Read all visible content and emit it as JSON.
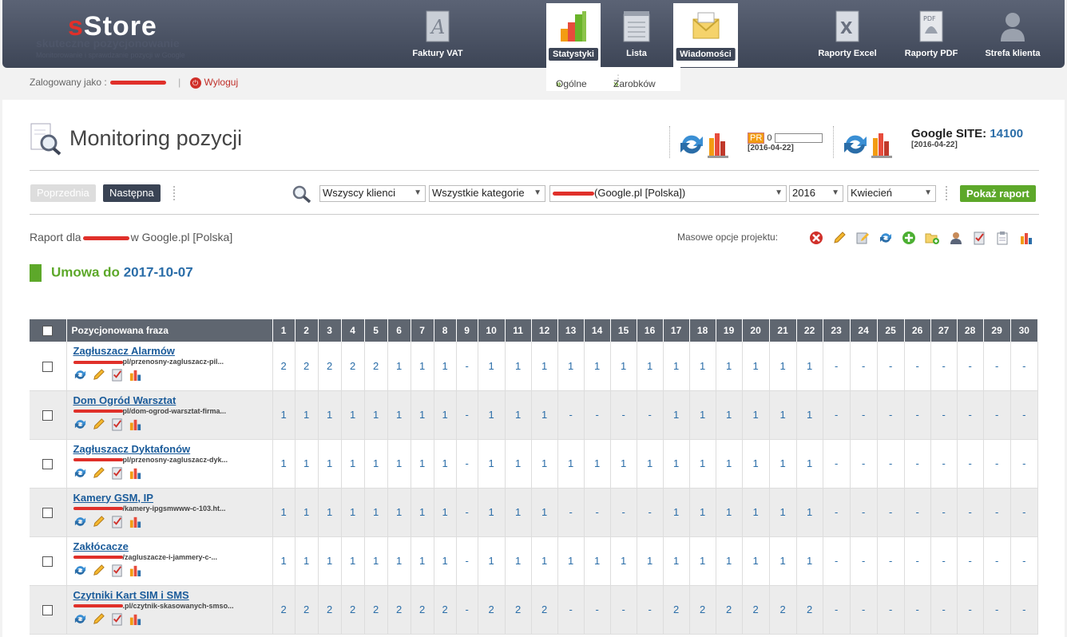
{
  "brand": {
    "logo_s": "s",
    "logo_rest": "Store",
    "tagline": "skuteczne pozycjonowanie",
    "tagline2": "Monitorowanie i sprawdzanie pozycji w Google"
  },
  "nav": {
    "items": [
      {
        "label": "Faktury VAT",
        "icon": "invoice-icon"
      },
      {
        "label": "Statystyki",
        "icon": "bar-chart-icon"
      },
      {
        "label": "Lista",
        "icon": "list-icon"
      },
      {
        "label": "Wiadomości",
        "icon": "envelope-icon"
      },
      {
        "label": "Raporty Excel",
        "icon": "excel-icon"
      },
      {
        "label": "Raporty PDF",
        "icon": "pdf-icon"
      },
      {
        "label": "Strefa klienta",
        "icon": "user-icon"
      }
    ],
    "submenu": [
      "Ogólne",
      "Zarobków"
    ]
  },
  "login": {
    "prefix": "Zalogowany jako :",
    "separator": "|",
    "logout": "Wyloguj"
  },
  "page": {
    "title": "Monitoring pozycji",
    "pr_label": "PR",
    "pr_value": "0",
    "pr_date": "[2016-04-22]",
    "google_site_label": "Google SITE:",
    "google_site_value": "14100",
    "google_site_date": "[2016-04-22]"
  },
  "toolbar": {
    "prev": "Poprzednia",
    "next": "Następna",
    "client": "Wszyscy klienci",
    "category": "Wszystkie kategorie",
    "project": "(Google.pl [Polska])",
    "year": "2016",
    "month": "Kwiecień",
    "show": "Pokaż raport"
  },
  "report": {
    "prefix": "Raport dla",
    "suffix": "w Google.pl [Polska]",
    "mass_label": "Masowe opcje projektu:"
  },
  "contract": {
    "label": "Umowa do",
    "date": "2017-10-07"
  },
  "table": {
    "phrase_header": "Pozycjonowana fraza",
    "days": [
      "1",
      "2",
      "3",
      "4",
      "5",
      "6",
      "7",
      "8",
      "9",
      "10",
      "11",
      "12",
      "13",
      "14",
      "15",
      "16",
      "17",
      "18",
      "19",
      "20",
      "21",
      "22",
      "23",
      "24",
      "25",
      "26",
      "27",
      "28",
      "29",
      "30"
    ],
    "rows": [
      {
        "name": "Zagłuszacz Alarmów",
        "url": "pl/przenosny-zagluszacz-pil...",
        "pos": [
          "2",
          "2",
          "2",
          "2",
          "2",
          "1",
          "1",
          "1",
          "-",
          "1",
          "1",
          "1",
          "1",
          "1",
          "1",
          "1",
          "1",
          "1",
          "1",
          "1",
          "1",
          "1",
          "-",
          "-",
          "-",
          "-",
          "-",
          "-",
          "-",
          "-"
        ]
      },
      {
        "name": "Dom Ogród Warsztat",
        "url": "pl/dom-ogrod-warsztat-firma...",
        "pos": [
          "1",
          "1",
          "1",
          "1",
          "1",
          "1",
          "1",
          "1",
          "-",
          "1",
          "1",
          "1",
          "-",
          "-",
          "-",
          "-",
          "1",
          "1",
          "1",
          "1",
          "1",
          "1",
          "-",
          "-",
          "-",
          "-",
          "-",
          "-",
          "-",
          "-"
        ]
      },
      {
        "name": "Zagłuszacz Dyktafonów",
        "url": "pl/przenosny-zagluszacz-dyk...",
        "pos": [
          "1",
          "1",
          "1",
          "1",
          "1",
          "1",
          "1",
          "1",
          "-",
          "1",
          "1",
          "1",
          "1",
          "1",
          "1",
          "1",
          "1",
          "1",
          "1",
          "1",
          "1",
          "1",
          "-",
          "-",
          "-",
          "-",
          "-",
          "-",
          "-",
          "-"
        ]
      },
      {
        "name": "Kamery GSM, IP",
        "url": "/kamery-ipgsmwww-c-103.ht...",
        "pos": [
          "1",
          "1",
          "1",
          "1",
          "1",
          "1",
          "1",
          "1",
          "-",
          "1",
          "1",
          "1",
          "-",
          "-",
          "-",
          "-",
          "1",
          "1",
          "1",
          "1",
          "1",
          "1",
          "-",
          "-",
          "-",
          "-",
          "-",
          "-",
          "-",
          "-"
        ]
      },
      {
        "name": "Zakłócacze",
        "url": "/zagluszacze-i-jammery-c-...",
        "pos": [
          "1",
          "1",
          "1",
          "1",
          "1",
          "1",
          "1",
          "1",
          "-",
          "1",
          "1",
          "1",
          "1",
          "1",
          "1",
          "1",
          "1",
          "1",
          "1",
          "1",
          "1",
          "1",
          "-",
          "-",
          "-",
          "-",
          "-",
          "-",
          "-",
          "-"
        ]
      },
      {
        "name": "Czytniki Kart SIM i SMS",
        "url": ".pl/czytnik-skasowanych-smso...",
        "pos": [
          "2",
          "2",
          "2",
          "2",
          "2",
          "2",
          "2",
          "2",
          "-",
          "2",
          "2",
          "2",
          "-",
          "-",
          "-",
          "-",
          "2",
          "2",
          "2",
          "2",
          "2",
          "2",
          "-",
          "-",
          "-",
          "-",
          "-",
          "-",
          "-",
          "-"
        ]
      }
    ]
  }
}
